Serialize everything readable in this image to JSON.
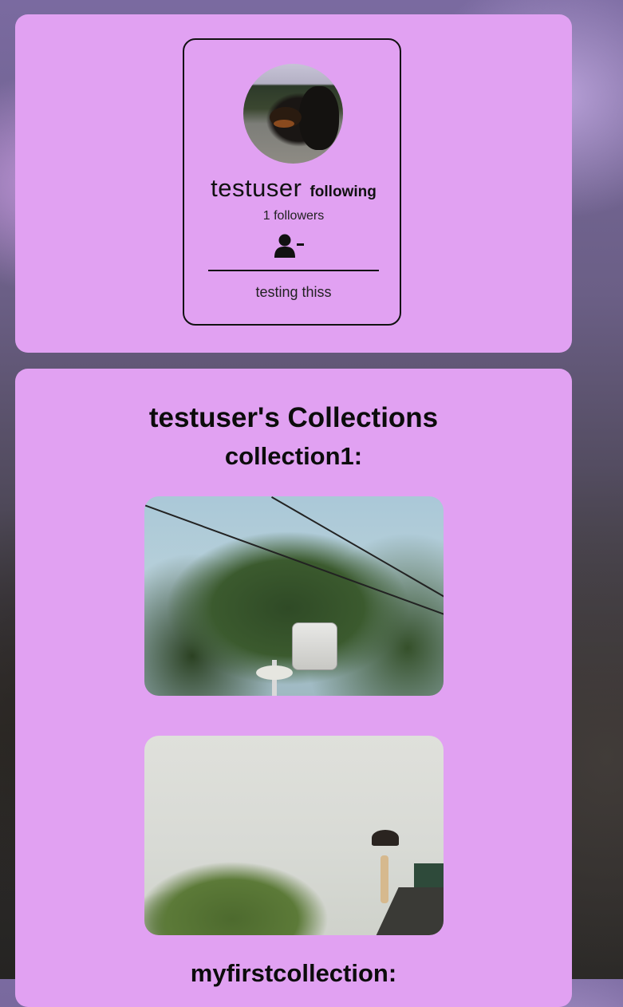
{
  "profile": {
    "username": "testuser",
    "follow_status": "following",
    "followers_text": "1 followers",
    "bio": "testing thiss"
  },
  "collections": {
    "title": "testuser's Collections",
    "items": [
      {
        "name": "collection1:"
      },
      {
        "name": "myfirstcollection:"
      }
    ]
  },
  "colors": {
    "card_background": "#e1a1f2",
    "text": "#0c0c0c"
  },
  "icons": {
    "unfollow": "user-minus-icon"
  }
}
